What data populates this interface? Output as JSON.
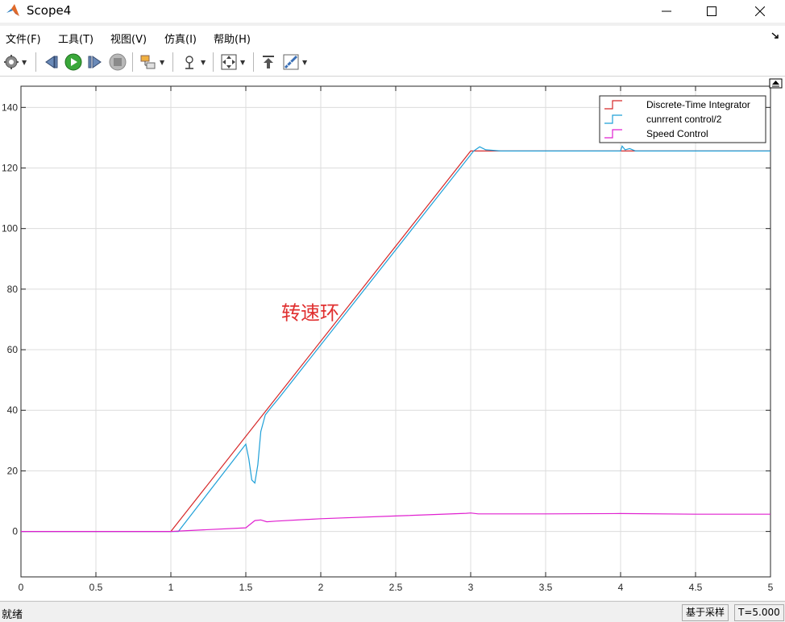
{
  "window": {
    "title": "Scope4"
  },
  "menu": [
    "文件(F)",
    "工具(T)",
    "视图(V)",
    "仿真(I)",
    "帮助(H)"
  ],
  "toolbar": {
    "icons": [
      "settings-icon",
      "step-back-icon",
      "run-icon",
      "step-forward-icon",
      "stop-icon",
      "highlight-block-icon",
      "cursor-measure-icon",
      "zoom-fit-icon",
      "autoscale-icon",
      "measurement-icon"
    ]
  },
  "status": {
    "left": "就绪",
    "mode": "基于采样",
    "time": "T=5.000"
  },
  "colors": {
    "discrete": "#d62728",
    "current": "#1fa0d8",
    "speed": "#e020d0",
    "annotation": "#e03030"
  },
  "chart_data": {
    "type": "line",
    "xlim": [
      0,
      5
    ],
    "ylim": [
      -15,
      147
    ],
    "x_ticks": [
      0,
      0.5,
      1,
      1.5,
      2,
      2.5,
      3,
      3.5,
      4,
      4.5,
      5
    ],
    "x_tick_labels": [
      "0",
      "0.5",
      "1",
      "1.5",
      "2",
      "2.5",
      "3",
      "3.5",
      "4",
      "4.5",
      "5"
    ],
    "y_ticks": [
      0,
      20,
      40,
      60,
      80,
      100,
      120,
      140
    ],
    "y_tick_labels": [
      "0",
      "20",
      "40",
      "60",
      "80",
      "100",
      "120",
      "140"
    ],
    "grid": true,
    "legend_position": "top-right",
    "annotation": "转速环",
    "series": [
      {
        "name": "Discrete-Time Integrator",
        "color": "#d62728",
        "x": [
          0,
          1.0,
          3.0,
          5.0
        ],
        "y": [
          0,
          0,
          125.6,
          125.6
        ]
      },
      {
        "name": "cunrrent control/2",
        "color": "#1fa0d8",
        "x": [
          0,
          1.05,
          1.5,
          1.52,
          1.54,
          1.56,
          1.58,
          1.6,
          1.63,
          1.67,
          1.72,
          3.02,
          3.06,
          3.1,
          3.2,
          4.0,
          4.01,
          4.03,
          4.06,
          4.1,
          5.0
        ],
        "y": [
          0,
          0,
          28.8,
          24,
          17,
          16,
          22,
          33,
          38.5,
          41,
          44,
          125.6,
          127,
          126,
          125.6,
          125.6,
          127.2,
          126,
          126.4,
          125.6,
          125.6
        ]
      },
      {
        "name": "Speed Control",
        "color": "#e020d0",
        "x": [
          0,
          1.0,
          1.5,
          1.52,
          1.56,
          1.6,
          1.64,
          1.7,
          2.0,
          2.5,
          2.97,
          3.0,
          3.05,
          3.5,
          4.0,
          4.5,
          5.0
        ],
        "y": [
          0,
          0,
          1.2,
          2.0,
          3.6,
          3.8,
          3.2,
          3.4,
          4.2,
          5.1,
          6.0,
          6.1,
          5.8,
          5.8,
          5.9,
          5.7,
          5.7
        ]
      }
    ]
  }
}
